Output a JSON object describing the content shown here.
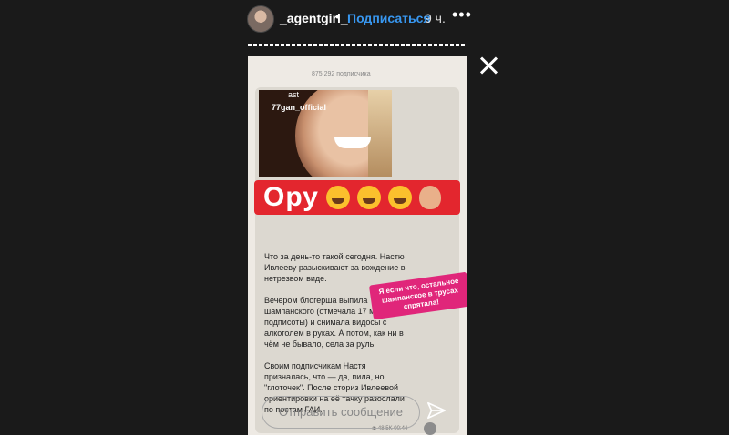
{
  "header": {
    "username": "_agentgirl_",
    "separator": "•",
    "follow_label": "Подписаться",
    "time": "9 ч.",
    "more": "•••"
  },
  "story": {
    "top_hint": "875 292 подписчика",
    "video_users": [
      "ast",
      "77gan_official"
    ],
    "headline": "Ору",
    "paragraphs": [
      "Что за день-то такой сегодня. Настю Ивлееву разыскивают за вождение в нетрезвом виде.",
      "Вечером блогерша выпила шампанского (отмечала 17 миллионов подписоты) и снимала видосы с алкоголем в руках. А потом, как ни в чём не бывало, села за руль.",
      "Своим подписчикам Настя призналась, что — да, пила, но \"глоточек\". После сториз Ивлеевой ориентировки на её тачку разослали по постам ГАИ."
    ],
    "sticker_text": "Я если что, остальное шампанское в трусах спрятала!",
    "meta": "◉ 48,5K 00:44"
  },
  "reply": {
    "placeholder": "Отправить сообщение"
  }
}
